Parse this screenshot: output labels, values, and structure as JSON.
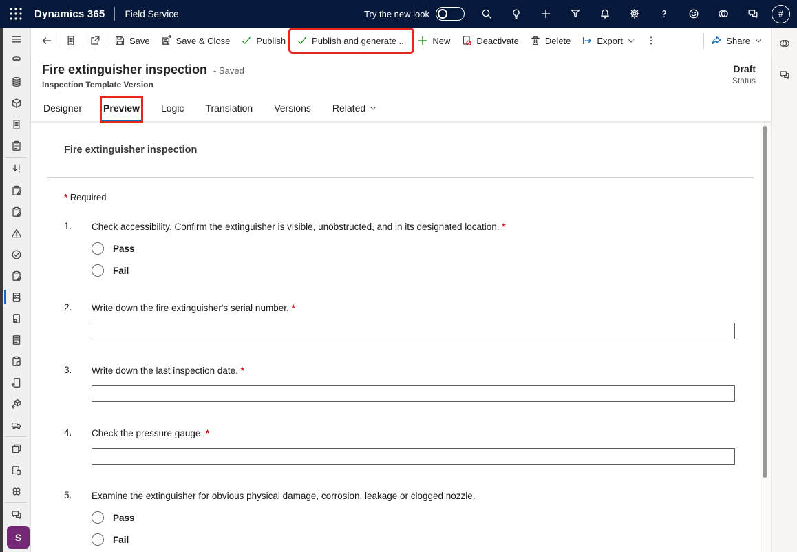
{
  "topbar": {
    "app_title": "Dynamics 365",
    "app_area": "Field Service",
    "try_new_look_label": "Try the new look",
    "new_look_toggle_state": "off",
    "avatar_initials": "#",
    "icons": [
      {
        "name": "search-icon",
        "icon": "search"
      },
      {
        "name": "lightbulb-icon",
        "icon": "bulb"
      },
      {
        "name": "quick-create-icon",
        "icon": "plus"
      },
      {
        "name": "filter-icon",
        "icon": "filter"
      },
      {
        "name": "notifications-icon",
        "icon": "bell"
      },
      {
        "name": "settings-gear-icon",
        "icon": "gear"
      },
      {
        "name": "help-icon",
        "icon": "help"
      },
      {
        "name": "feedback-smiley-icon",
        "icon": "smiley"
      },
      {
        "name": "copilot-icon",
        "icon": "copilot"
      },
      {
        "name": "teams-chat-icon",
        "icon": "chat"
      }
    ]
  },
  "command_bar": {
    "items": [
      {
        "kind": "icon",
        "name": "back-button",
        "icon": "back"
      },
      {
        "kind": "sep"
      },
      {
        "kind": "icon",
        "name": "form-summary-button",
        "icon": "docpage"
      },
      {
        "kind": "sep"
      },
      {
        "kind": "icon",
        "name": "popout-button",
        "icon": "popout"
      },
      {
        "kind": "sep"
      },
      {
        "kind": "button",
        "name": "save-button",
        "icon": "save",
        "label": "Save"
      },
      {
        "kind": "button",
        "name": "save-and-close-button",
        "icon": "saveclose",
        "label": "Save & Close"
      },
      {
        "kind": "button",
        "name": "publish-button",
        "icon": "check",
        "icon_color": "green",
        "label": "Publish"
      },
      {
        "kind": "button",
        "name": "publish-and-generate-button",
        "icon": "check",
        "icon_color": "green",
        "label": "Publish and generate ...",
        "annotated": true
      },
      {
        "kind": "button",
        "name": "new-button",
        "icon": "plusgreen",
        "icon_color": "green",
        "label": "New"
      },
      {
        "kind": "button",
        "name": "deactivate-button",
        "icon": "deactivate",
        "label": "Deactivate"
      },
      {
        "kind": "button",
        "name": "delete-button",
        "icon": "trash",
        "label": "Delete"
      },
      {
        "kind": "button",
        "name": "export-button",
        "icon": "export",
        "icon_color": "blue",
        "label": "Export",
        "chevron": true
      },
      {
        "kind": "icon",
        "name": "more-commands-button",
        "icon": "dotsv"
      }
    ],
    "share_label": "Share"
  },
  "record_header": {
    "title": "Fire extinguisher inspection",
    "saved_indicator": "- Saved",
    "entity_type": "Inspection Template Version",
    "status_value": "Draft",
    "status_label": "Status"
  },
  "tabs": [
    {
      "label": "Designer"
    },
    {
      "label": "Preview",
      "active": true,
      "highlighted": true
    },
    {
      "label": "Logic"
    },
    {
      "label": "Translation"
    },
    {
      "label": "Versions"
    },
    {
      "label": "Related",
      "has_chevron": true
    }
  ],
  "preview_form": {
    "title": "Fire extinguisher inspection",
    "required_marker": "*",
    "required_note": "Required",
    "questions": [
      {
        "number": "1.",
        "text": "Check accessibility. Confirm the extinguisher is visible, unobstructed, and in its designated location.",
        "required": true,
        "type": "radio",
        "options": [
          "Pass",
          "Fail"
        ]
      },
      {
        "number": "2.",
        "text": "Write down the fire extinguisher's serial number.",
        "required": true,
        "type": "text",
        "value": "",
        "placeholder": ""
      },
      {
        "number": "3.",
        "text": "Write down the last inspection date.",
        "required": true,
        "type": "text",
        "value": "",
        "placeholder": ""
      },
      {
        "number": "4.",
        "text": "Check the pressure gauge.",
        "required": true,
        "type": "text",
        "value": "",
        "placeholder": ""
      },
      {
        "number": "5.",
        "text": "Examine the extinguisher for obvious physical damage, corrosion, leakage or clogged nozzle.",
        "required": false,
        "type": "radio",
        "options": [
          "Pass",
          "Fail"
        ]
      }
    ]
  },
  "sidebar": {
    "environment_badge": "S",
    "items": [
      {
        "name": "sidebar-menu-toggle",
        "icon": "hamburger",
        "menu": true
      },
      {
        "name": "sidebar-item-entities-partial",
        "icon": "dbhalf"
      },
      {
        "name": "sidebar-item-data",
        "icon": "database"
      },
      {
        "name": "sidebar-item-products",
        "icon": "cube"
      },
      {
        "name": "sidebar-item-documents",
        "icon": "doc"
      },
      {
        "name": "sidebar-item-work-orders",
        "icon": "clipboard",
        "divider_after": true
      },
      {
        "name": "sidebar-item-bookings",
        "icon": "importexcl"
      },
      {
        "name": "sidebar-item-service-tasks",
        "icon": "clipedit"
      },
      {
        "name": "sidebar-item-task-types",
        "icon": "clipedit"
      },
      {
        "name": "sidebar-item-incident-types",
        "icon": "warning"
      },
      {
        "name": "sidebar-item-resolutions",
        "icon": "checkcircle"
      },
      {
        "name": "sidebar-item-inspections",
        "icon": "clippen"
      },
      {
        "name": "sidebar-item-inspection-templates",
        "icon": "docchecklist",
        "selected": true
      },
      {
        "name": "sidebar-item-certificates",
        "icon": "doccert"
      },
      {
        "name": "sidebar-item-reports",
        "icon": "doclines"
      },
      {
        "name": "sidebar-item-assets",
        "icon": "clipcube"
      },
      {
        "name": "sidebar-item-returns",
        "icon": "docreturn"
      },
      {
        "name": "sidebar-item-rma",
        "icon": "cubereturn"
      },
      {
        "name": "sidebar-item-fleet",
        "icon": "truck",
        "divider_after": true
      },
      {
        "name": "sidebar-item-copy",
        "icon": "copy"
      },
      {
        "name": "sidebar-item-drafts",
        "icon": "docdashed"
      },
      {
        "name": "sidebar-item-connections",
        "icon": "clover",
        "divider_after": true
      },
      {
        "name": "sidebar-item-chat",
        "icon": "chat",
        "accent": true
      }
    ]
  },
  "right_rail": {
    "icons": [
      {
        "name": "copilot-icon",
        "icon": "copilot"
      },
      {
        "name": "comments-icon",
        "icon": "chat",
        "purple": true
      }
    ]
  },
  "annotations": [
    {
      "target": "publish-and-generate-button",
      "shape": "red-rectangle"
    },
    {
      "target": "tab-preview",
      "shape": "red-rectangle"
    }
  ],
  "colors": {
    "topbar_bg": "#06193b",
    "accent_blue": "#0f6cbd",
    "green": "#107c10",
    "annotation_red": "#e8251f",
    "required_red": "#c50f1f",
    "environment_badge_purple": "#742774",
    "chat_purple": "#5b5fc7"
  }
}
